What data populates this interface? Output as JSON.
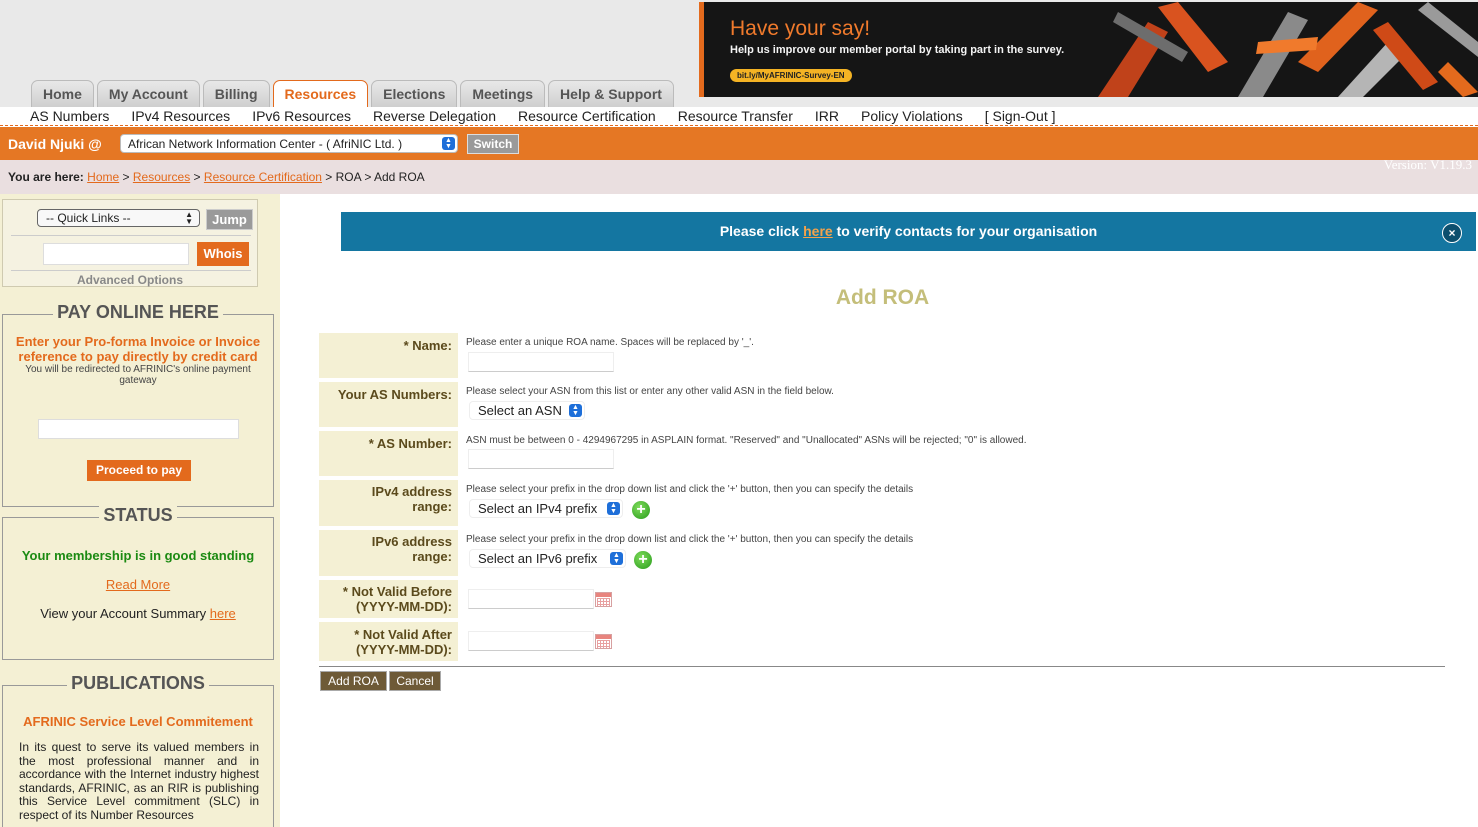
{
  "banner": {
    "title": "Have your say!",
    "text": "Help us improve our member portal by taking part in the survey.",
    "link": "bit.ly/MyAFRINIC-Survey-EN"
  },
  "tabs": [
    "Home",
    "My Account",
    "Billing",
    "Resources",
    "Elections",
    "Meetings",
    "Help & Support"
  ],
  "active_tab": "Resources",
  "subnav": [
    "AS Numbers",
    "IPv4 Resources",
    "IPv6 Resources",
    "Reverse Delegation",
    "Resource Certification",
    "Resource Transfer",
    "IRR",
    "Policy Violations",
    "[ Sign-Out ]"
  ],
  "user": {
    "name": "David Njuki @",
    "org_selected": "African Network Information Center - ( AfriNIC Ltd. )",
    "switch_label": "Switch"
  },
  "breadcrumb": {
    "label": "You are here:",
    "links": [
      "Home",
      "Resources",
      "Resource Certification"
    ],
    "tail": " > ROA > Add ROA",
    "sep": " > "
  },
  "version": "Version: V1.19.3",
  "sidebar": {
    "quick_links": "-- Quick Links --",
    "jump": "Jump",
    "whois": "Whois",
    "advanced": "Advanced Options",
    "pay": {
      "legend": "PAY ONLINE HERE",
      "heading": "Enter your Pro-forma Invoice or Invoice reference to pay directly by credit card",
      "note": "You will be redirected to AFRINIC's online payment gateway",
      "button": "Proceed to pay"
    },
    "status": {
      "legend": "STATUS",
      "text": "Your membership is in good standing",
      "read_more": "Read More",
      "summary_prefix": "View your Account Summary ",
      "summary_link": "here"
    },
    "publications": {
      "legend": "PUBLICATIONS",
      "title": "AFRINIC Service Level Commitement",
      "body": "In its quest to serve its valued members in the most professional manner and in accordance with the Internet industry highest standards, AFRINIC, as an RIR is publishing this Service Level commitment (SLC) in respect of its Number Resources"
    }
  },
  "notice": {
    "prefix": "Please click ",
    "link": "here",
    "suffix": " to verify contacts for your organisation",
    "close": "×"
  },
  "page_title": "Add ROA",
  "form": {
    "name_label": "* Name:",
    "name_help": "Please enter a unique ROA name. Spaces will be replaced by '_'.",
    "asn_list_label": "Your AS Numbers:",
    "asn_list_help": "Please select your ASN from this list or enter any other valid ASN in the field below.",
    "asn_list_select": "Select an ASN",
    "asn_label": "* AS Number:",
    "asn_help": "ASN must be between 0 - 4294967295 in ASPLAIN format. \"Reserved\" and \"Unallocated\" ASNs will be rejected; \"0\" is allowed.",
    "ipv4_label": "IPv4 address range:",
    "ipv4_help": "Please select your prefix in the drop down list and click the '+' button, then you can specify the details",
    "ipv4_select": "Select an IPv4 prefix",
    "ipv6_label": "IPv6 address range:",
    "ipv6_help": "Please select your prefix in the drop down list and click the '+' button, then you can specify the details",
    "ipv6_select": "Select an IPv6 prefix",
    "nvb_label": "* Not Valid Before (YYYY-MM-DD):",
    "nva_label": "* Not Valid After (YYYY-MM-DD):",
    "add_button": "Add ROA",
    "cancel_button": "Cancel"
  },
  "colors": {
    "brand_orange": "#e57724",
    "notice_blue": "#1476a1",
    "label_bg": "#f4f0d4",
    "status_green": "#1b8a12"
  }
}
